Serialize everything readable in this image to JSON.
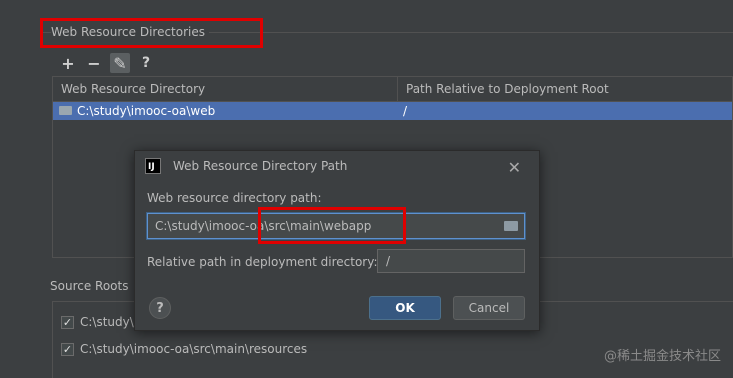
{
  "web_resource": {
    "section_title": "Web Resource Directories",
    "toolbar": {
      "add": "+",
      "remove": "−",
      "edit": "✎",
      "help": "?"
    },
    "columns": [
      "Web Resource Directory",
      "Path Relative to Deployment Root"
    ],
    "rows": [
      {
        "directory": "C:\\study\\imooc-oa\\web",
        "relative_path": "/"
      }
    ]
  },
  "source_roots": {
    "title": "Source Roots",
    "items": [
      {
        "path": "C:\\study\\",
        "checked": true
      },
      {
        "path": "C:\\study\\imooc-oa\\src\\main\\resources",
        "checked": true
      }
    ]
  },
  "dialog": {
    "icon_text": "IJ",
    "title": "Web Resource Directory Path",
    "close": "✕",
    "label_path": "Web resource directory path:",
    "path_value": "C:\\study\\imooc-oa\\src\\main\\webapp",
    "label_relative": "Relative path in deployment directory:",
    "relative_value": "/",
    "help": "?",
    "ok": "OK",
    "cancel": "Cancel"
  },
  "watermark": "@稀土掘金技术社区",
  "colors": {
    "background": "#3c3f41",
    "selection": "#4b6eaf",
    "highlight_box": "#e00000",
    "ok_button": "#365880"
  }
}
